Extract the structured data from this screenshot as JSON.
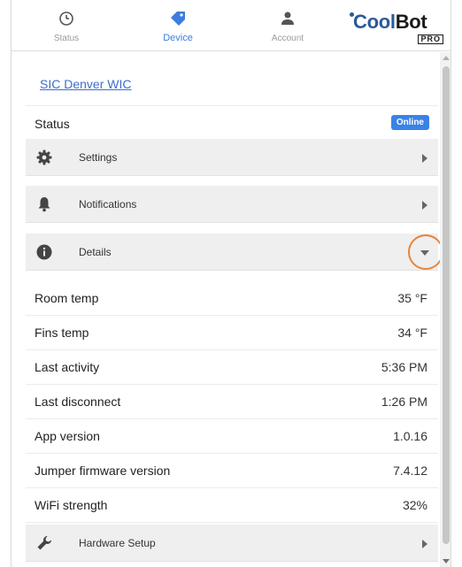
{
  "nav": {
    "tabs": [
      {
        "label": "Status",
        "icon": "clock-icon"
      },
      {
        "label": "Device",
        "icon": "tag-icon"
      },
      {
        "label": "Account",
        "icon": "person-icon"
      }
    ],
    "active_tab": "Device",
    "logo": {
      "brand_a": "Cool",
      "brand_b": "Bot",
      "suffix": "PRO"
    }
  },
  "device": {
    "name": "SIC Denver WIC"
  },
  "status": {
    "label": "Status",
    "badge": "Online",
    "badge_color": "#3a82e6"
  },
  "sections": {
    "settings": {
      "label": "Settings",
      "icon": "gear-icon"
    },
    "notifications": {
      "label": "Notifications",
      "icon": "bell-icon"
    },
    "details": {
      "label": "Details",
      "icon": "info-icon"
    },
    "hardware_setup": {
      "label": "Hardware Setup",
      "icon": "wrench-icon"
    }
  },
  "details": [
    {
      "key": "Room temp",
      "value": "35 °F"
    },
    {
      "key": "Fins temp",
      "value": "34 °F"
    },
    {
      "key": "Last activity",
      "value": "5:36 PM"
    },
    {
      "key": "Last disconnect",
      "value": "1:26 PM"
    },
    {
      "key": "App version",
      "value": "1.0.16"
    },
    {
      "key": "Jumper firmware version",
      "value": "7.4.12"
    },
    {
      "key": "WiFi strength",
      "value": "32%"
    }
  ],
  "colors": {
    "accent": "#3b7de0",
    "highlight": "#e8833a"
  }
}
